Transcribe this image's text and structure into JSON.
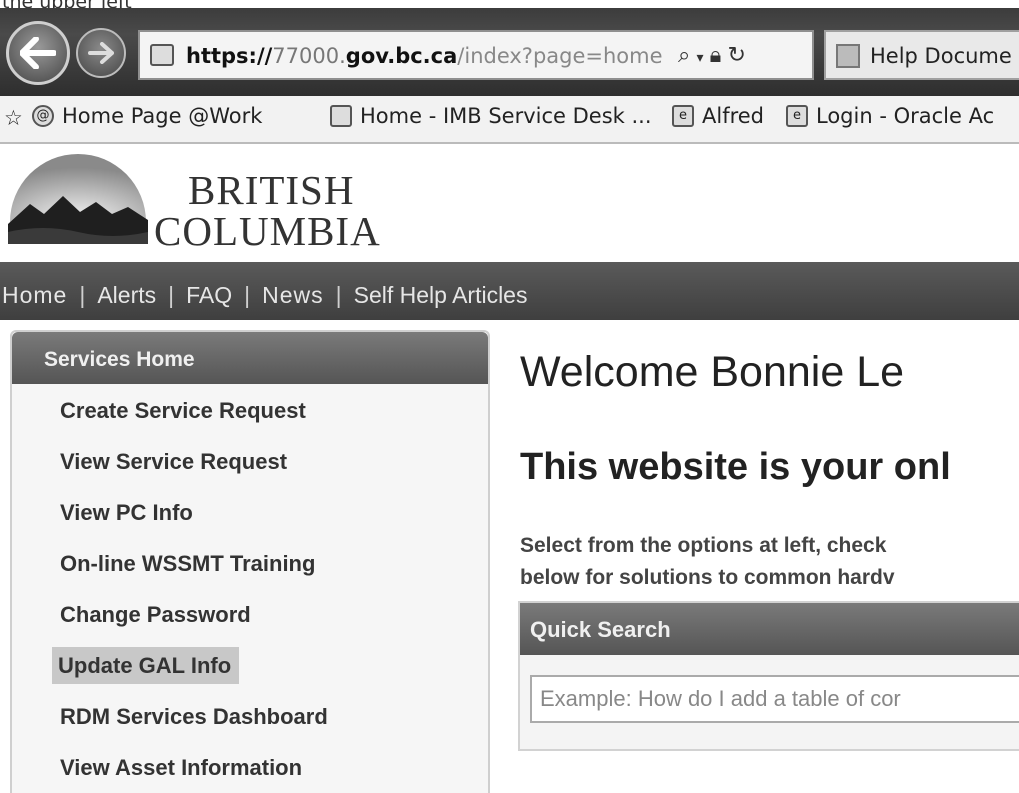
{
  "caption": "the upper left",
  "browser": {
    "url": {
      "scheme": "https://",
      "sub": "77000.",
      "domain": "gov.bc.ca",
      "path": "/index?page=home"
    },
    "tab_title": "Help Docume",
    "favorites": [
      {
        "label": "Home Page @Work",
        "icon": "@"
      },
      {
        "label": "Home - IMB Service Desk ...",
        "icon": "page"
      },
      {
        "label": "Alfred",
        "icon": "ie"
      },
      {
        "label": "Login - Oracle Ac",
        "icon": "ie"
      }
    ]
  },
  "header": {
    "logo_line1": "BRITISH",
    "logo_line2": "COLUMBIA"
  },
  "nav": [
    "Home",
    "Alerts",
    "FAQ",
    "News",
    "Self Help Articles"
  ],
  "sidebar": {
    "title": "Services Home",
    "items": [
      "Create Service Request",
      "View Service Request",
      "View PC Info",
      "On-line WSSMT Training",
      "Change Password",
      "Update GAL Info",
      "RDM Services Dashboard",
      "View Asset Information"
    ]
  },
  "main": {
    "welcome": "Welcome Bonnie Le",
    "subhead": "This website is your onl",
    "intro_line1": "Select from the options at left, check",
    "intro_line2": "below for solutions to common hardv"
  },
  "quick_search": {
    "title": "Quick Search",
    "placeholder": "Example: How do I add a table of cor"
  }
}
